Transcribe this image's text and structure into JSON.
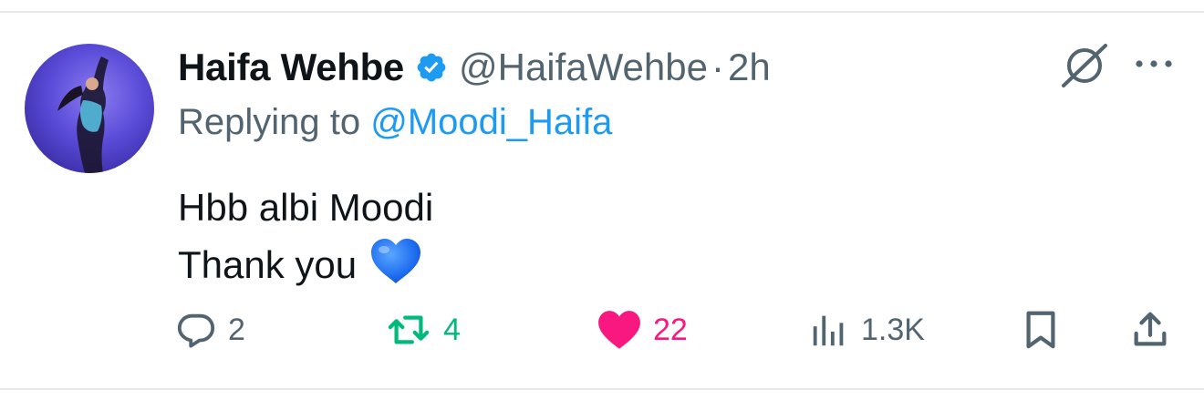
{
  "tweet": {
    "author_name": "Haifa Wehbe",
    "verified": true,
    "handle": "@HaifaWehbe",
    "separator": "·",
    "time": "2h",
    "replying_prefix": "Replying to",
    "replying_to": "@Moodi_Haifa",
    "text_lines": [
      "Hbb albi Moodi",
      "Thank you"
    ],
    "emoji": "blue-heart"
  },
  "actions": {
    "replies": "2",
    "retweets": "4",
    "likes": "22",
    "views": "1.3K"
  },
  "colors": {
    "text": "#0f1419",
    "secondary": "#536471",
    "link": "#1d9bf0",
    "verified": "#1d9bf0",
    "retweet": "#00ba7c",
    "like": "#f91880",
    "divider": "#e6e9ec"
  },
  "icons": [
    "verified-badge-icon",
    "grok-icon",
    "more-icon",
    "reply-icon",
    "retweet-icon",
    "like-icon",
    "views-icon",
    "bookmark-icon",
    "share-icon"
  ]
}
